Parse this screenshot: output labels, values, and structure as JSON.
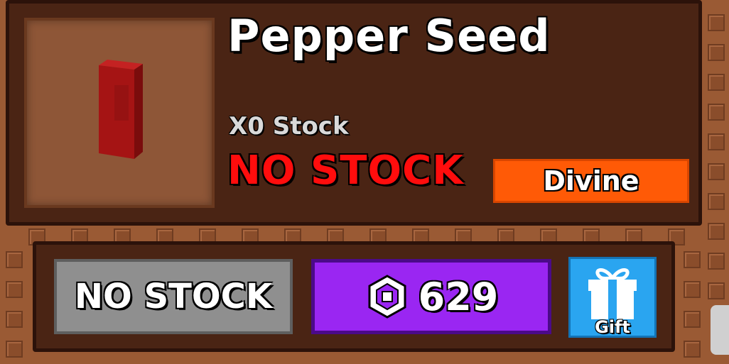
{
  "item": {
    "name": "Pepper Seed",
    "stock_count": "X0 Stock",
    "stock_status": "NO STOCK",
    "rarity": "Divine",
    "icon": "pepper-seed-pack-icon"
  },
  "actions": {
    "no_stock_label": "NO STOCK",
    "price": "629",
    "currency_icon": "robux-icon",
    "gift_label": "Gift",
    "gift_icon": "gift-box-icon"
  },
  "colors": {
    "panel": "#4a2414",
    "status_red": "#ff0d0d",
    "rarity_orange": "#ff5a06",
    "price_purple": "#9a26f2",
    "gift_blue": "#2aa5f0",
    "disabled_gray": "#8f8f8f"
  }
}
